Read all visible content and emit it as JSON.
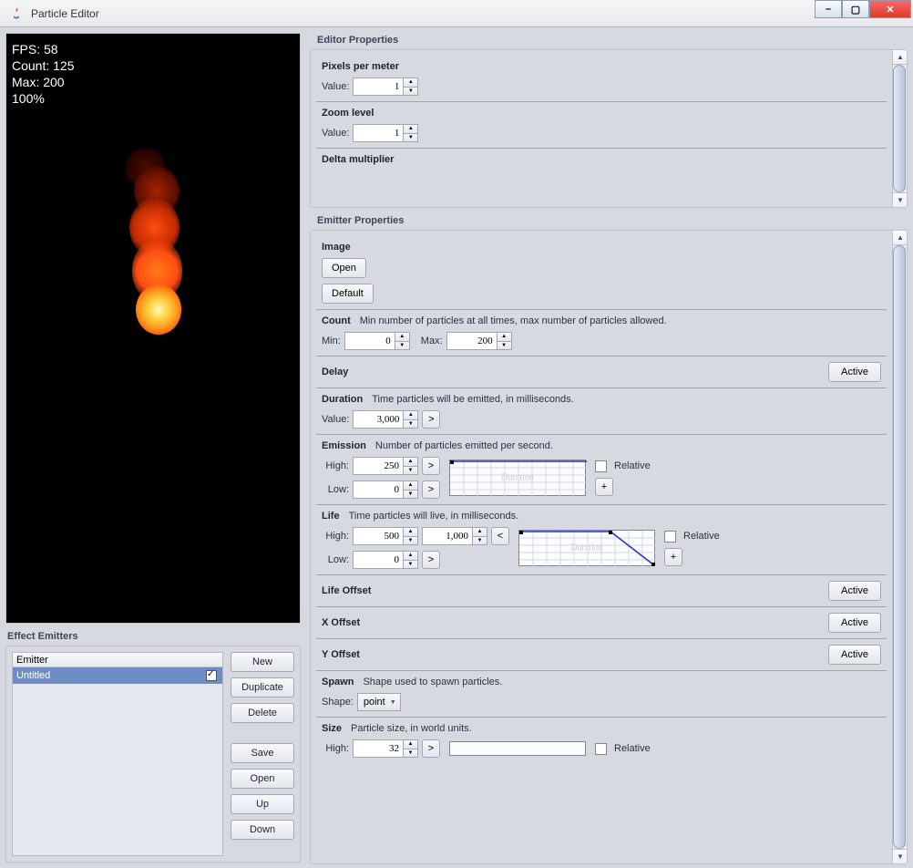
{
  "window": {
    "title": "Particle Editor"
  },
  "stats": {
    "fps": "FPS: 58",
    "count": "Count: 125",
    "max": "Max: 200",
    "pct": "100%"
  },
  "effect_emitters": {
    "label": "Effect Emitters",
    "header": "Emitter",
    "row": "Untitled",
    "buttons": {
      "new_": "New",
      "dup": "Duplicate",
      "del": "Delete",
      "save": "Save",
      "open": "Open",
      "up": "Up",
      "down": "Down"
    }
  },
  "editor_props": {
    "label": "Editor Properties",
    "ppm": {
      "title": "Pixels per meter",
      "value_lbl": "Value:",
      "value": "1"
    },
    "zoom": {
      "title": "Zoom level",
      "value_lbl": "Value:",
      "value": "1"
    },
    "delta": {
      "title": "Delta multiplier"
    }
  },
  "emitter_props": {
    "label": "Emitter Properties",
    "image": {
      "title": "Image",
      "open": "Open",
      "default": "Default"
    },
    "count": {
      "title": "Count",
      "sub": "Min number of particles at all times, max number of particles allowed.",
      "min_lbl": "Min:",
      "min": "0",
      "max_lbl": "Max:",
      "max": "200"
    },
    "delay": {
      "title": "Delay",
      "active": "Active"
    },
    "duration": {
      "title": "Duration",
      "sub": "Time particles will be emitted, in milliseconds.",
      "value_lbl": "Value:",
      "value": "3,000"
    },
    "emission": {
      "title": "Emission",
      "sub": "Number of particles emitted per second.",
      "high_lbl": "High:",
      "high": "250",
      "low_lbl": "Low:",
      "low": "0",
      "graph": "Duration",
      "relative": "Relative",
      "plus": "+"
    },
    "life": {
      "title": "Life",
      "sub": "Time particles will live, in milliseconds.",
      "high_lbl": "High:",
      "high": "500",
      "high2": "1,000",
      "low_lbl": "Low:",
      "low": "0",
      "graph": "Duration",
      "relative": "Relative",
      "plus": "+"
    },
    "life_offset": {
      "title": "Life Offset",
      "active": "Active"
    },
    "x_offset": {
      "title": "X Offset",
      "active": "Active"
    },
    "y_offset": {
      "title": "Y Offset",
      "active": "Active"
    },
    "spawn": {
      "title": "Spawn",
      "sub": "Shape used to spawn particles.",
      "shape_lbl": "Shape:",
      "shape": "point"
    },
    "size": {
      "title": "Size",
      "sub": "Particle size, in world units.",
      "high_lbl": "High:",
      "high": "32",
      "relative": "Relative"
    }
  }
}
